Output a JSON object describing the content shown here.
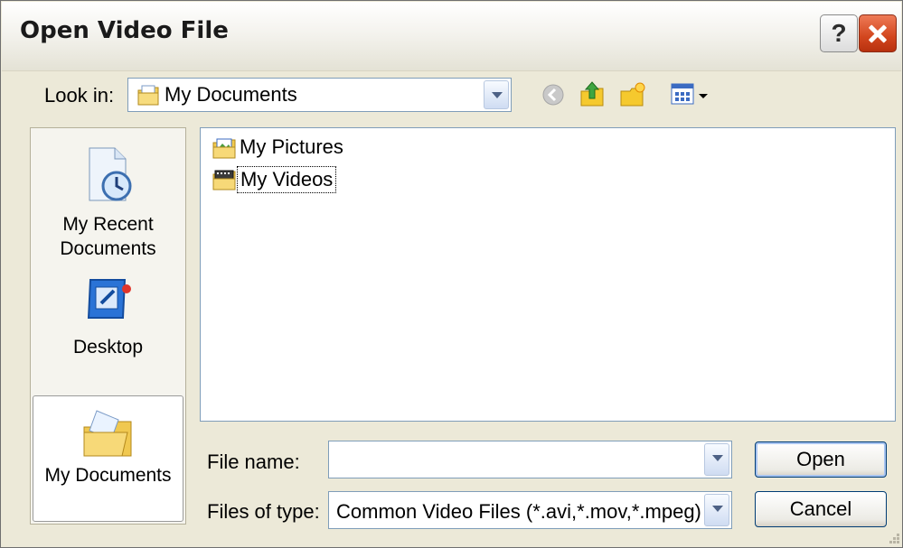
{
  "window": {
    "title": "Open Video File",
    "help_label": "?"
  },
  "toolbar": {
    "look_in_label": "Look in:",
    "look_in_value": "My Documents",
    "buttons": [
      "back-icon",
      "up-folder-icon",
      "new-folder-icon",
      "view-menu-icon"
    ]
  },
  "places": [
    {
      "label_line1": "My Recent",
      "label_line2": "Documents",
      "icon": "recent-documents-icon"
    },
    {
      "label_line1": "Desktop",
      "label_line2": "",
      "icon": "desktop-icon"
    },
    {
      "label_line1": "My Documents",
      "label_line2": "",
      "icon": "my-documents-icon"
    }
  ],
  "files": [
    {
      "name": "My Pictures",
      "icon": "pictures-folder-icon"
    },
    {
      "name": "My Videos",
      "icon": "videos-folder-icon"
    }
  ],
  "form": {
    "file_name_label": "File name:",
    "file_name_value": "",
    "file_type_label": "Files of type:",
    "file_type_value": "Common Video Files (*.avi,*.mov,*.mpeg)"
  },
  "buttons": {
    "open": "Open",
    "cancel": "Cancel"
  }
}
